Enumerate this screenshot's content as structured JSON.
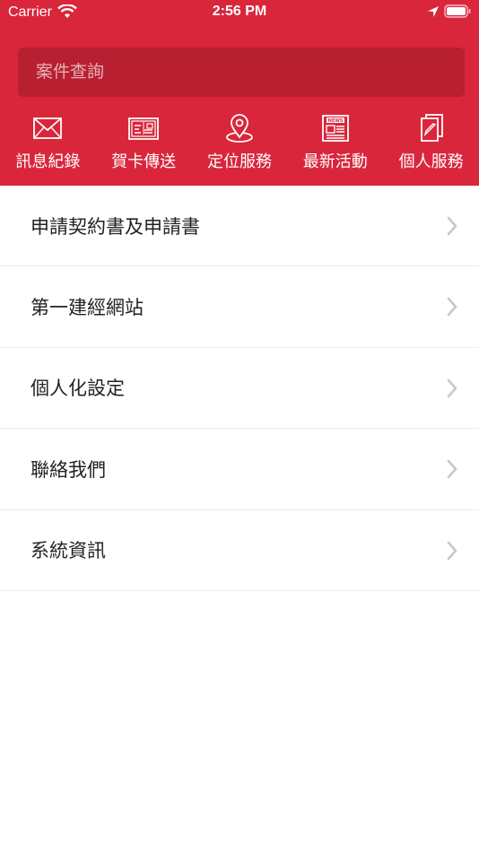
{
  "status_bar": {
    "carrier": "Carrier",
    "time": "2:56 PM"
  },
  "theme": {
    "header_color": "#d9263b",
    "search_bg": "#b81f31"
  },
  "search": {
    "placeholder": "案件查詢"
  },
  "quick_actions": [
    {
      "label": "訊息紀錄",
      "icon": "mail-icon"
    },
    {
      "label": "賀卡傳送",
      "icon": "greeting-card-icon"
    },
    {
      "label": "定位服務",
      "icon": "location-pin-icon"
    },
    {
      "label": "最新活動",
      "icon": "newspaper-icon"
    },
    {
      "label": "個人服務",
      "icon": "document-pen-icon"
    }
  ],
  "menu": [
    {
      "label": "申請契約書及申請書"
    },
    {
      "label": "第一建經網站"
    },
    {
      "label": "個人化設定"
    },
    {
      "label": "聯絡我們"
    },
    {
      "label": "系統資訊"
    }
  ]
}
